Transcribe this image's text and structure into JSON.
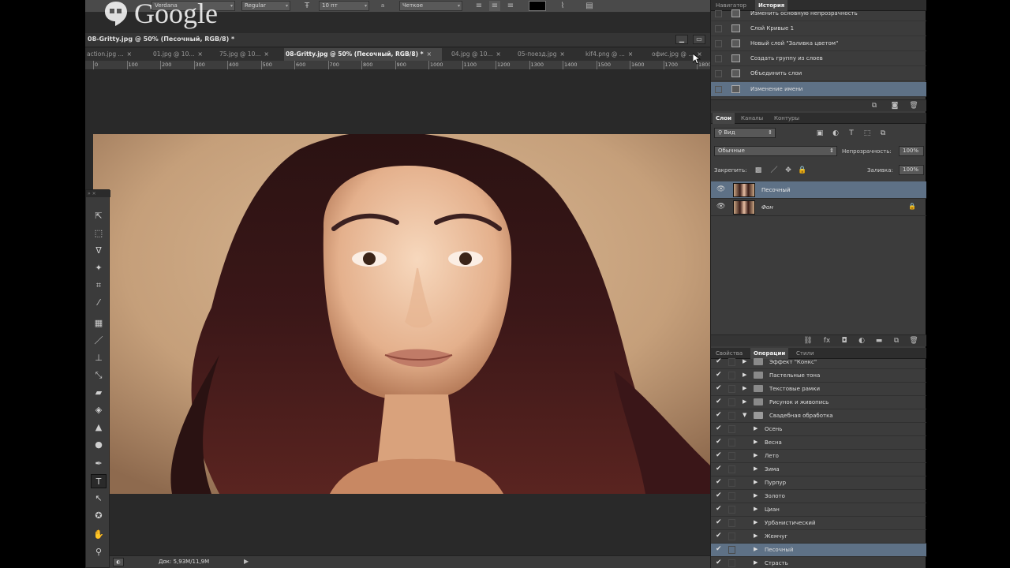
{
  "options_bar": {
    "font_family": "Verdana",
    "font_style": "Regular",
    "font_size": "10 пт",
    "antialias": "Четкое"
  },
  "overlay": {
    "logo_text": "Google"
  },
  "document": {
    "title": "08-Gritty.jpg @ 50% (Песочный, RGB/8) *",
    "tabs": [
      {
        "label": "action.jpg ..."
      },
      {
        "label": "01.jpg @ 10..."
      },
      {
        "label": "75.jpg @ 10..."
      },
      {
        "label": "08-Gritty.jpg @ 50% (Песочный, RGB/8) *"
      },
      {
        "label": "04.jpg @ 10..."
      },
      {
        "label": "05-поезд.jpg"
      },
      {
        "label": "kif4.png @ ..."
      },
      {
        "label": "офис.jpg @ ..."
      }
    ],
    "ruler_ticks": [
      "0",
      "100",
      "200",
      "300",
      "400",
      "500",
      "600",
      "700",
      "800",
      "900",
      "1000",
      "1100",
      "1200",
      "1300",
      "1400",
      "1500",
      "1600",
      "1700",
      "1800"
    ],
    "status_doc_size": "Док: 5,93M/11,9M"
  },
  "history_panel": {
    "tabs": [
      "Навигатор",
      "История"
    ],
    "items": [
      {
        "label": "Изменить основную непрозрачность"
      },
      {
        "label": "Слой Кривые 1"
      },
      {
        "label": "Новый слой \"Заливка цветом\""
      },
      {
        "label": "Создать группу из слоев"
      },
      {
        "label": "Объединить слои"
      },
      {
        "label": "Изменение имени"
      }
    ]
  },
  "layers_panel": {
    "tabs": [
      "Слои",
      "Каналы",
      "Контуры"
    ],
    "filter": "Вид",
    "blend_mode": "Обычные",
    "opacity_label": "Непрозрачность:",
    "opacity_value": "100%",
    "lock_label": "Закрепить:",
    "fill_label": "Заливка:",
    "fill_value": "100%",
    "layers": [
      {
        "name": "Песочный"
      },
      {
        "name": "Фон"
      }
    ]
  },
  "actions_panel": {
    "tabs": [
      "Свойства",
      "Операции",
      "Стили"
    ],
    "rows": [
      {
        "label": "Эффект \"Конкс\"",
        "type": "folder"
      },
      {
        "label": "Пастельные тона",
        "type": "folder"
      },
      {
        "label": "Текстовые рамки",
        "type": "folder"
      },
      {
        "label": "Рисунок и живопись",
        "type": "folder"
      },
      {
        "label": "Свадебная обработка",
        "type": "folder-open"
      },
      {
        "label": "Осень",
        "type": "action"
      },
      {
        "label": "Весна",
        "type": "action"
      },
      {
        "label": "Лето",
        "type": "action"
      },
      {
        "label": "Зима",
        "type": "action"
      },
      {
        "label": "Пурпур",
        "type": "action"
      },
      {
        "label": "Золото",
        "type": "action"
      },
      {
        "label": "Циан",
        "type": "action"
      },
      {
        "label": "Урбанистический",
        "type": "action"
      },
      {
        "label": "Жемчуг",
        "type": "action"
      },
      {
        "label": "Песочный",
        "type": "action"
      },
      {
        "label": "Страсть",
        "type": "action"
      }
    ]
  },
  "colors": {
    "panel_bg": "#3c3c3c",
    "selection": "#5e7186",
    "workspace": "#2a2a2a"
  }
}
